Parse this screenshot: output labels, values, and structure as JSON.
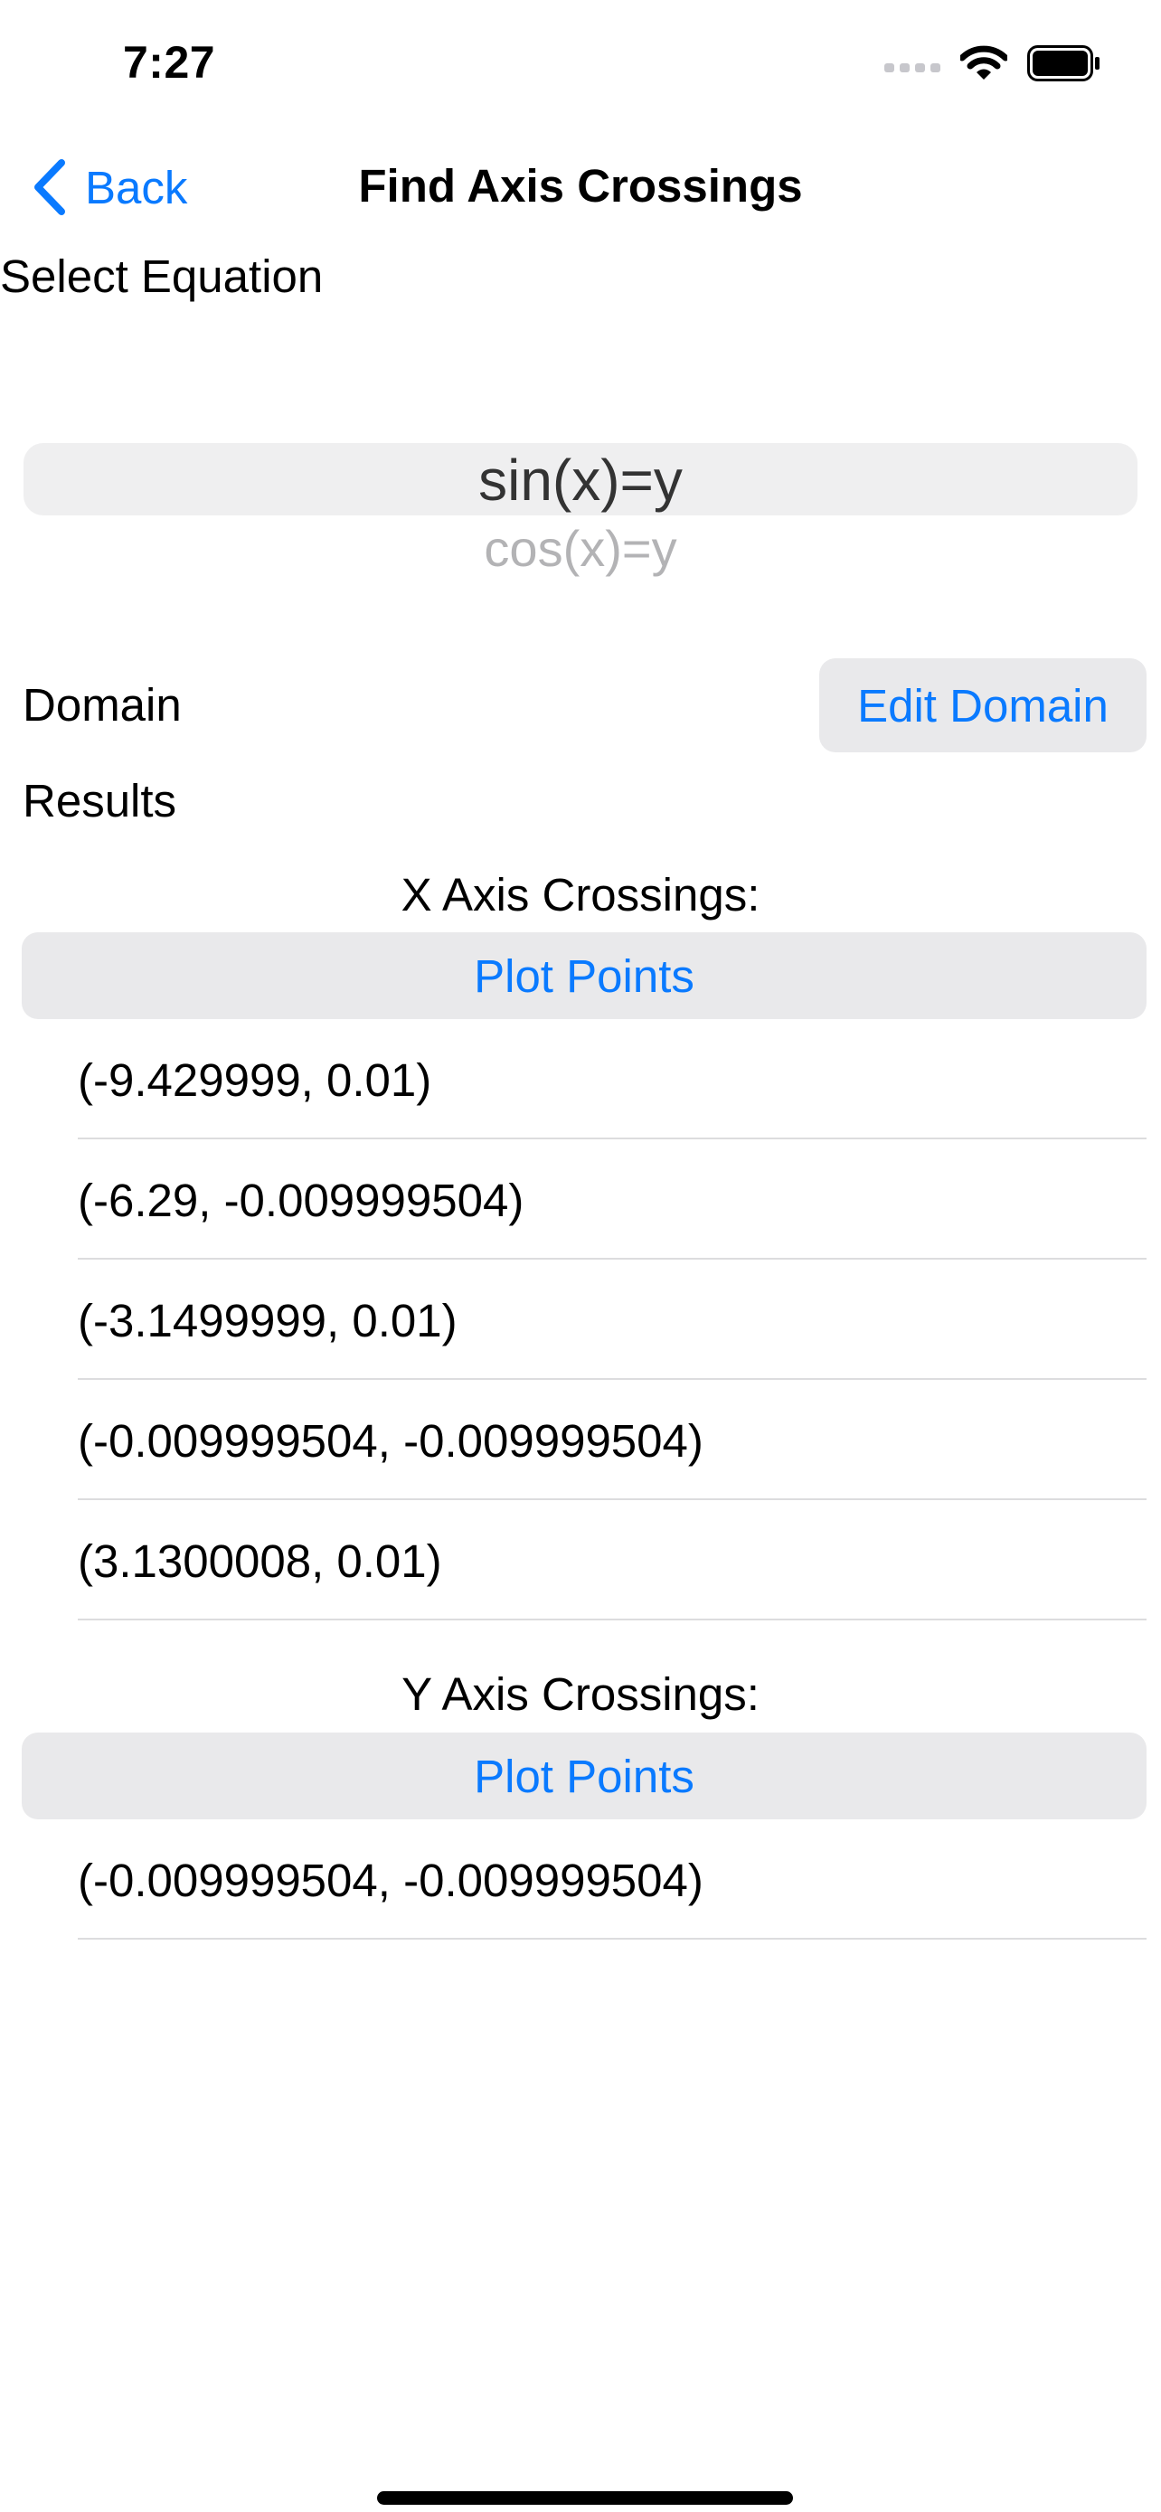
{
  "status_bar": {
    "time": "7:27",
    "icons": [
      "cellular-signal-icon",
      "wifi-icon",
      "battery-icon"
    ]
  },
  "nav": {
    "back_label": "Back",
    "title": "Find Axis Crossings"
  },
  "equation": {
    "label": "Select Equation",
    "selected": "sin(x)=y",
    "next_option": "cos(x)=y"
  },
  "domain": {
    "label": "Domain",
    "edit_button": "Edit Domain"
  },
  "results": {
    "label": "Results",
    "x_axis": {
      "title": "X Axis Crossings:",
      "plot_button": "Plot Points",
      "points": [
        "(-9.429999, 0.01)",
        "(-6.29, -0.009999504)",
        "(-3.1499999, 0.01)",
        "(-0.009999504, -0.009999504)",
        "(3.1300008, 0.01)"
      ]
    },
    "y_axis": {
      "title": "Y Axis Crossings:",
      "plot_button": "Plot Points",
      "points": [
        "(-0.009999504, -0.009999504)"
      ]
    }
  },
  "colors": {
    "accent": "#0a7aff",
    "button_background": "#e9e9eb",
    "picker_highlight": "#efeff0",
    "divider": "#dcdcde"
  }
}
